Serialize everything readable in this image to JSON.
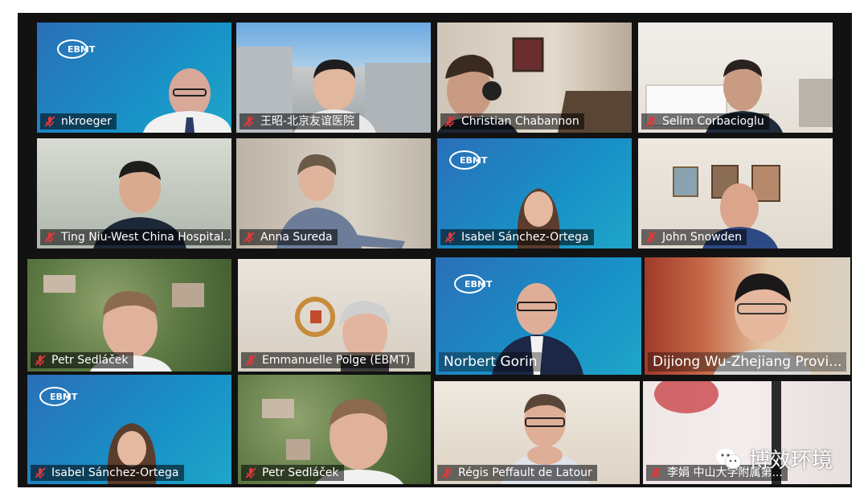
{
  "participants": [
    {
      "name": "nkroeger"
    },
    {
      "name": "王昭-北京友谊医院"
    },
    {
      "name": "Christian Chabannon"
    },
    {
      "name": "Selim Corbacioglu"
    },
    {
      "name": "Ting Niu-West China Hospital..."
    },
    {
      "name": "Anna Sureda"
    },
    {
      "name": "Isabel Sánchez-Ortega"
    },
    {
      "name": "John Snowden"
    },
    {
      "name": "Petr Sedláček"
    },
    {
      "name": "Emmanuelle Polge (EBMT)"
    },
    {
      "name": "Norbert Gorin"
    },
    {
      "name": "Dijiong Wu-Zhejiang Provi..."
    },
    {
      "name": "Isabel Sánchez-Ortega"
    },
    {
      "name": "Petr Sedláček"
    },
    {
      "name": "Régis Peffault de Latour"
    },
    {
      "name": "李娟 中山大学附属第..."
    }
  ],
  "brand": {
    "logo_text": "EBMT",
    "accent": "#1a7fc0"
  },
  "watermark": {
    "text": "博效环境",
    "icon": "wechat-icon"
  },
  "colors": {
    "muted_mic": "#e0383c",
    "active_speaker_border": "#8fce4a"
  }
}
